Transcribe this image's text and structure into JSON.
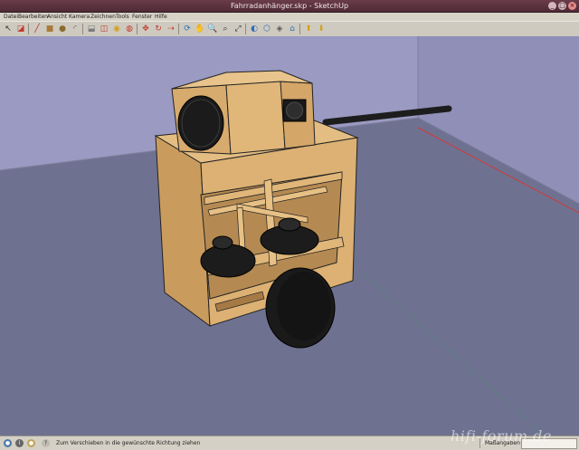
{
  "window": {
    "title": "Fahrradanhänger.skp - SketchUp",
    "minimize_glyph": "_",
    "maximize_glyph": "□",
    "close_glyph": "×"
  },
  "menu": [
    {
      "label": "Datei"
    },
    {
      "label": "Bearbeiten"
    },
    {
      "label": "Ansicht"
    },
    {
      "label": "Kamera"
    },
    {
      "label": "Zeichnen"
    },
    {
      "label": "Tools"
    },
    {
      "label": "Fenster"
    },
    {
      "label": "Hilfe"
    }
  ],
  "toolbar": {
    "tools": [
      {
        "icon": "select-arrow-icon",
        "glyph": "↖",
        "color": "#333333"
      },
      {
        "icon": "eraser-icon",
        "glyph": "◪",
        "color": "#c0392b"
      },
      {
        "icon": "pencil-line-icon",
        "glyph": "╱",
        "color": "#b03030"
      },
      {
        "icon": "rectangle-icon",
        "glyph": "■",
        "color": "#a87a3a"
      },
      {
        "icon": "circle-icon",
        "glyph": "●",
        "color": "#8a6a2a"
      },
      {
        "icon": "arc-icon",
        "glyph": "◜",
        "color": "#555555"
      },
      {
        "icon": "push-pull-icon",
        "glyph": "⬓",
        "color": "#7a7a7a"
      },
      {
        "icon": "offset-icon",
        "glyph": "◫",
        "color": "#c0392b"
      },
      {
        "icon": "tape-measure-icon",
        "glyph": "◉",
        "color": "#d4a017"
      },
      {
        "icon": "paint-bucket-icon",
        "glyph": "◍",
        "color": "#c0392b"
      },
      {
        "icon": "move-icon",
        "glyph": "✥",
        "color": "#c0392b"
      },
      {
        "icon": "rotate-icon",
        "glyph": "↻",
        "color": "#c0392b"
      },
      {
        "icon": "follow-me-icon",
        "glyph": "⇢",
        "color": "#c0392b"
      },
      {
        "icon": "orbit-icon",
        "glyph": "⟳",
        "color": "#2a6fb8"
      },
      {
        "icon": "pan-hand-icon",
        "glyph": "✋",
        "color": "#e8e8e8"
      },
      {
        "icon": "zoom-icon",
        "glyph": "🔍",
        "color": "#333333"
      },
      {
        "icon": "zoom-window-icon",
        "glyph": "⌕",
        "color": "#333333"
      },
      {
        "icon": "zoom-extents-icon",
        "glyph": "⤢",
        "color": "#333333"
      },
      {
        "icon": "previous-view-icon",
        "glyph": "◐",
        "color": "#2a6fb8"
      },
      {
        "icon": "iso-view-icon",
        "glyph": "⬡",
        "color": "#2a6fb8"
      },
      {
        "icon": "components-icon",
        "glyph": "◈",
        "color": "#5a5a5a"
      },
      {
        "icon": "3d-warehouse-icon",
        "glyph": "⌂",
        "color": "#2a6fb8"
      },
      {
        "icon": "get-models-icon",
        "glyph": "⬆",
        "color": "#d4a017"
      },
      {
        "icon": "share-model-icon",
        "glyph": "⬇",
        "color": "#d4a017"
      }
    ]
  },
  "status": {
    "message": "Zum Verschieben in die gewünschte Richtung ziehen",
    "measurements_label": "Maßangaben",
    "measurements_value": ""
  },
  "watermark": "hifi-forum.de",
  "colors": {
    "sky": "#9797bf",
    "ground": "#6d7190",
    "wood": "#d9ae73",
    "speaker": "#1b1b1b",
    "axis_red": "#d23a3a",
    "axis_green": "#2e8b57"
  }
}
